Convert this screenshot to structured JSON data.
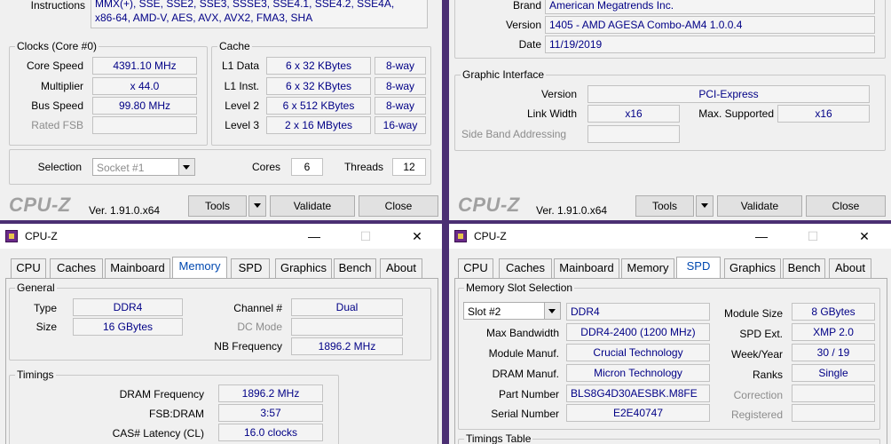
{
  "w1": {
    "instructions_label": "Instructions",
    "instructions_line1": "MMX(+), SSE, SSE2, SSE3, SSSE3, SSE4.1, SSE4.2, SSE4A,",
    "instructions_line2": "x86-64, AMD-V, AES, AVX, AVX2, FMA3, SHA",
    "clocks_title": "Clocks (Core #0)",
    "core_speed_label": "Core Speed",
    "core_speed": "4391.10 MHz",
    "multiplier_label": "Multiplier",
    "multiplier": "x 44.0",
    "bus_speed_label": "Bus Speed",
    "bus_speed": "99.80 MHz",
    "rated_fsb_label": "Rated FSB",
    "cache_title": "Cache",
    "l1data_label": "L1 Data",
    "l1data": "6 x 32 KBytes",
    "l1data_way": "8-way",
    "l1inst_label": "L1 Inst.",
    "l1inst": "6 x 32 KBytes",
    "l1inst_way": "8-way",
    "l2_label": "Level 2",
    "l2": "6 x 512 KBytes",
    "l2_way": "8-way",
    "l3_label": "Level 3",
    "l3": "2 x 16 MBytes",
    "l3_way": "16-way",
    "selection_label": "Selection",
    "selection_value": "Socket #1",
    "cores_label": "Cores",
    "cores": "6",
    "threads_label": "Threads",
    "threads": "12",
    "logo": "CPU-Z",
    "version": "Ver. 1.91.0.x64",
    "tools": "Tools",
    "validate": "Validate",
    "close": "Close"
  },
  "w2": {
    "brand_label": "Brand",
    "brand": "American Megatrends Inc.",
    "version_label": "Version",
    "version_value": "1405 - AMD AGESA Combo-AM4 1.0.0.4",
    "date_label": "Date",
    "date": "11/19/2019",
    "graphic_title": "Graphic Interface",
    "gi_version_label": "Version",
    "gi_version": "PCI-Express",
    "link_width_label": "Link Width",
    "link_width": "x16",
    "max_supported_label": "Max. Supported",
    "max_supported": "x16",
    "side_band_label": "Side Band Addressing",
    "logo": "CPU-Z",
    "version": "Ver. 1.91.0.x64",
    "tools": "Tools",
    "validate": "Validate",
    "close": "Close"
  },
  "w3": {
    "title": "CPU-Z",
    "minimize": "—",
    "maximize": "☐",
    "close_x": "✕",
    "tabs": [
      "CPU",
      "Caches",
      "Mainboard",
      "Memory",
      "SPD",
      "Graphics",
      "Bench",
      "About"
    ],
    "general_title": "General",
    "type_label": "Type",
    "type": "DDR4",
    "size_label": "Size",
    "size": "16 GBytes",
    "channel_label": "Channel #",
    "channel": "Dual",
    "dc_mode_label": "DC Mode",
    "nb_freq_label": "NB Frequency",
    "nb_freq": "1896.2 MHz",
    "timings_title": "Timings",
    "dram_freq_label": "DRAM Frequency",
    "dram_freq": "1896.2 MHz",
    "fsb_dram_label": "FSB:DRAM",
    "fsb_dram": "3:57",
    "cas_label": "CAS# Latency (CL)",
    "cas": "16.0 clocks"
  },
  "w4": {
    "title": "CPU-Z",
    "minimize": "—",
    "maximize": "☐",
    "close_x": "✕",
    "tabs": [
      "CPU",
      "Caches",
      "Mainboard",
      "Memory",
      "SPD",
      "Graphics",
      "Bench",
      "About"
    ],
    "slot_title": "Memory Slot Selection",
    "slot_value": "Slot #2",
    "slot_type": "DDR4",
    "module_size_label": "Module Size",
    "module_size": "8 GBytes",
    "max_bw_label": "Max Bandwidth",
    "max_bw": "DDR4-2400 (1200 MHz)",
    "spd_ext_label": "SPD Ext.",
    "spd_ext": "XMP 2.0",
    "module_manuf_label": "Module Manuf.",
    "module_manuf": "Crucial Technology",
    "week_year_label": "Week/Year",
    "week_year": "30 / 19",
    "dram_manuf_label": "DRAM Manuf.",
    "dram_manuf": "Micron Technology",
    "ranks_label": "Ranks",
    "ranks": "Single",
    "part_label": "Part Number",
    "part": "BLS8G4D30AESBK.M8FE",
    "correction_label": "Correction",
    "serial_label": "Serial Number",
    "serial": "E2E40747",
    "registered_label": "Registered",
    "timings_table_title": "Timings Table"
  }
}
